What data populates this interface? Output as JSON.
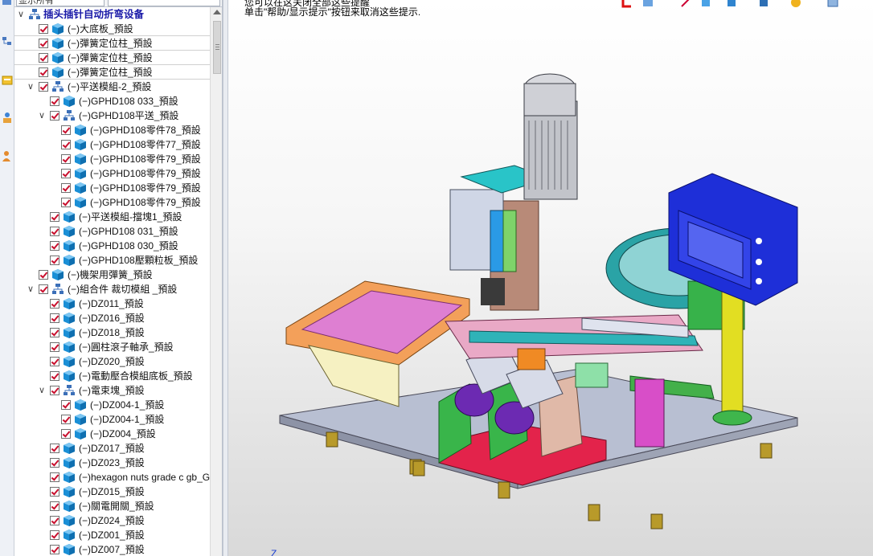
{
  "header": {
    "search_value": "显示所有"
  },
  "viewport": {
    "hint_line1": "您可以在这关闭全部这些提醒",
    "hint_line2": "单击\"帮助/显示提示\"按钮来取消这些提示.",
    "axis_label": "Z"
  },
  "tree": {
    "root": "插头插针自动折弯设备",
    "items": [
      {
        "label": "(−)大底板_預設",
        "level": 1,
        "type": "part"
      },
      {
        "label": "(−)彈簧定位柱_預設",
        "level": 1,
        "type": "part"
      },
      {
        "label": "(−)彈簧定位柱_預設",
        "level": 1,
        "type": "part"
      },
      {
        "label": "(−)彈簧定位柱_預設",
        "level": 1,
        "type": "part"
      },
      {
        "label": "(−)平送模組-2_預設",
        "level": 1,
        "type": "assembly",
        "expanded": true
      },
      {
        "label": "(−)GPHD108 033_預設",
        "level": 2,
        "type": "part"
      },
      {
        "label": "(−)GPHD108平送_預設",
        "level": 2,
        "type": "assembly",
        "expanded": true
      },
      {
        "label": "(−)GPHD108零件78_預設",
        "level": 3,
        "type": "part"
      },
      {
        "label": "(−)GPHD108零件77_預設",
        "level": 3,
        "type": "part"
      },
      {
        "label": "(−)GPHD108零件79_預設",
        "level": 3,
        "type": "part"
      },
      {
        "label": "(−)GPHD108零件79_預設",
        "level": 3,
        "type": "part"
      },
      {
        "label": "(−)GPHD108零件79_預設",
        "level": 3,
        "type": "part"
      },
      {
        "label": "(−)GPHD108零件79_預設",
        "level": 3,
        "type": "part"
      },
      {
        "label": "(−)平送模組-擋塊1_預設",
        "level": 2,
        "type": "part"
      },
      {
        "label": "(−)GPHD108 031_預設",
        "level": 2,
        "type": "part"
      },
      {
        "label": "(−)GPHD108 030_預設",
        "level": 2,
        "type": "part"
      },
      {
        "label": "(−)GPHD108壓顆粒板_預設",
        "level": 2,
        "type": "part"
      },
      {
        "label": "(−)機架用彈簧_預設",
        "level": 1,
        "type": "part"
      },
      {
        "label": "(−)組合件 裁切模組 _預設",
        "level": 1,
        "type": "assembly",
        "expanded": true
      },
      {
        "label": "(−)DZ011_預設",
        "level": 2,
        "type": "part"
      },
      {
        "label": "(−)DZ016_預設",
        "level": 2,
        "type": "part"
      },
      {
        "label": "(−)DZ018_預設",
        "level": 2,
        "type": "part"
      },
      {
        "label": "(−)圓柱滾子軸承_預設",
        "level": 2,
        "type": "part"
      },
      {
        "label": "(−)DZ020_預設",
        "level": 2,
        "type": "part"
      },
      {
        "label": "(−)電動壓合模組底板_預設",
        "level": 2,
        "type": "part"
      },
      {
        "label": "(−)電束塊_預設",
        "level": 2,
        "type": "assembly",
        "expanded": true
      },
      {
        "label": "(−)DZ004-1_預設",
        "level": 3,
        "type": "part"
      },
      {
        "label": "(−)DZ004-1_預設",
        "level": 3,
        "type": "part"
      },
      {
        "label": "(−)DZ004_預設",
        "level": 3,
        "type": "part"
      },
      {
        "label": "(−)DZ017_預設",
        "level": 2,
        "type": "part"
      },
      {
        "label": "(−)DZ023_預設",
        "level": 2,
        "type": "part"
      },
      {
        "label": "(−)hexagon nuts grade c gb_G",
        "level": 2,
        "type": "part"
      },
      {
        "label": "(−)DZ015_預設",
        "level": 2,
        "type": "part"
      },
      {
        "label": "(−)關電開關_預設",
        "level": 2,
        "type": "part"
      },
      {
        "label": "(−)DZ024_預設",
        "level": 2,
        "type": "part"
      },
      {
        "label": "(−)DZ001_預設",
        "level": 2,
        "type": "part"
      },
      {
        "label": "(−)DZ007_預設",
        "level": 2,
        "type": "part"
      }
    ]
  },
  "colors": {
    "tree_root_text": "#1a1aa8",
    "check_mark": "#c8102e",
    "part_icon": "#1a8fd6",
    "assembly_icon": "#3b6fb8"
  },
  "icons": {
    "part": "cube-icon",
    "assembly": "assembly-icon",
    "expanded": "chevron-down-icon"
  }
}
